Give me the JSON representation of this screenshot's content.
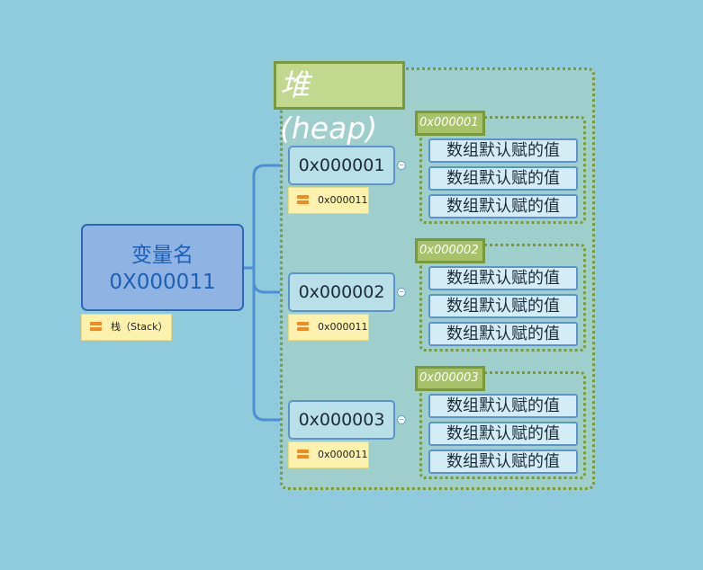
{
  "heap": {
    "title": "堆(heap)"
  },
  "root": {
    "line1": "变量名",
    "line2": "0X000011",
    "note": "栈（Stack）"
  },
  "groups": [
    {
      "label": "0x000001",
      "address": "0x000001",
      "note": "0x000011",
      "items": [
        "数组默认赋的值",
        "数组默认赋的值",
        "数组默认赋的值"
      ]
    },
    {
      "label": "0x000002",
      "address": "0x000002",
      "note": "0x000011",
      "items": [
        "数组默认赋的值",
        "数组默认赋的值",
        "数组默认赋的值"
      ]
    },
    {
      "label": "0x000003",
      "address": "0x000003",
      "note": "0x000011",
      "items": [
        "数组默认赋的值",
        "数组默认赋的值",
        "数组默认赋的值"
      ]
    }
  ],
  "colors": {
    "background": "#8fcadd",
    "heap_border": "#7a9a3a",
    "root_fill": "#8fb4e4",
    "connector": "#4f8ed6",
    "note_fill": "#fdf2ad"
  }
}
